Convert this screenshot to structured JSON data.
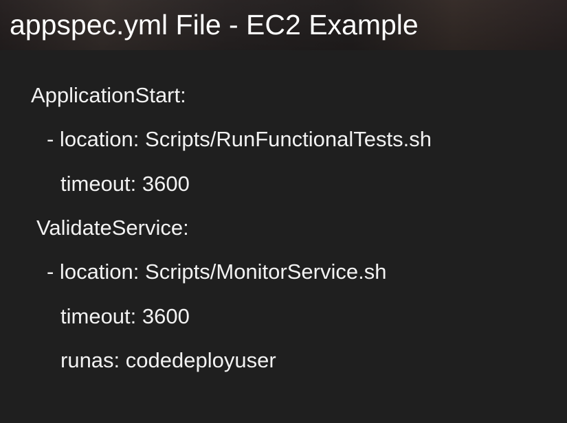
{
  "slide": {
    "title": "appspec.yml File - EC2 Example",
    "lines": [
      "ApplicationStart:",
      "- location: Scripts/RunFunctionalTests.sh",
      "timeout: 3600",
      "ValidateService:",
      "- location: Scripts/MonitorService.sh",
      "timeout: 3600",
      "runas: codedeployuser"
    ]
  },
  "colors": {
    "background": "#1f1f1f",
    "text": "#f2f2f2",
    "title_text": "#ffffff"
  }
}
